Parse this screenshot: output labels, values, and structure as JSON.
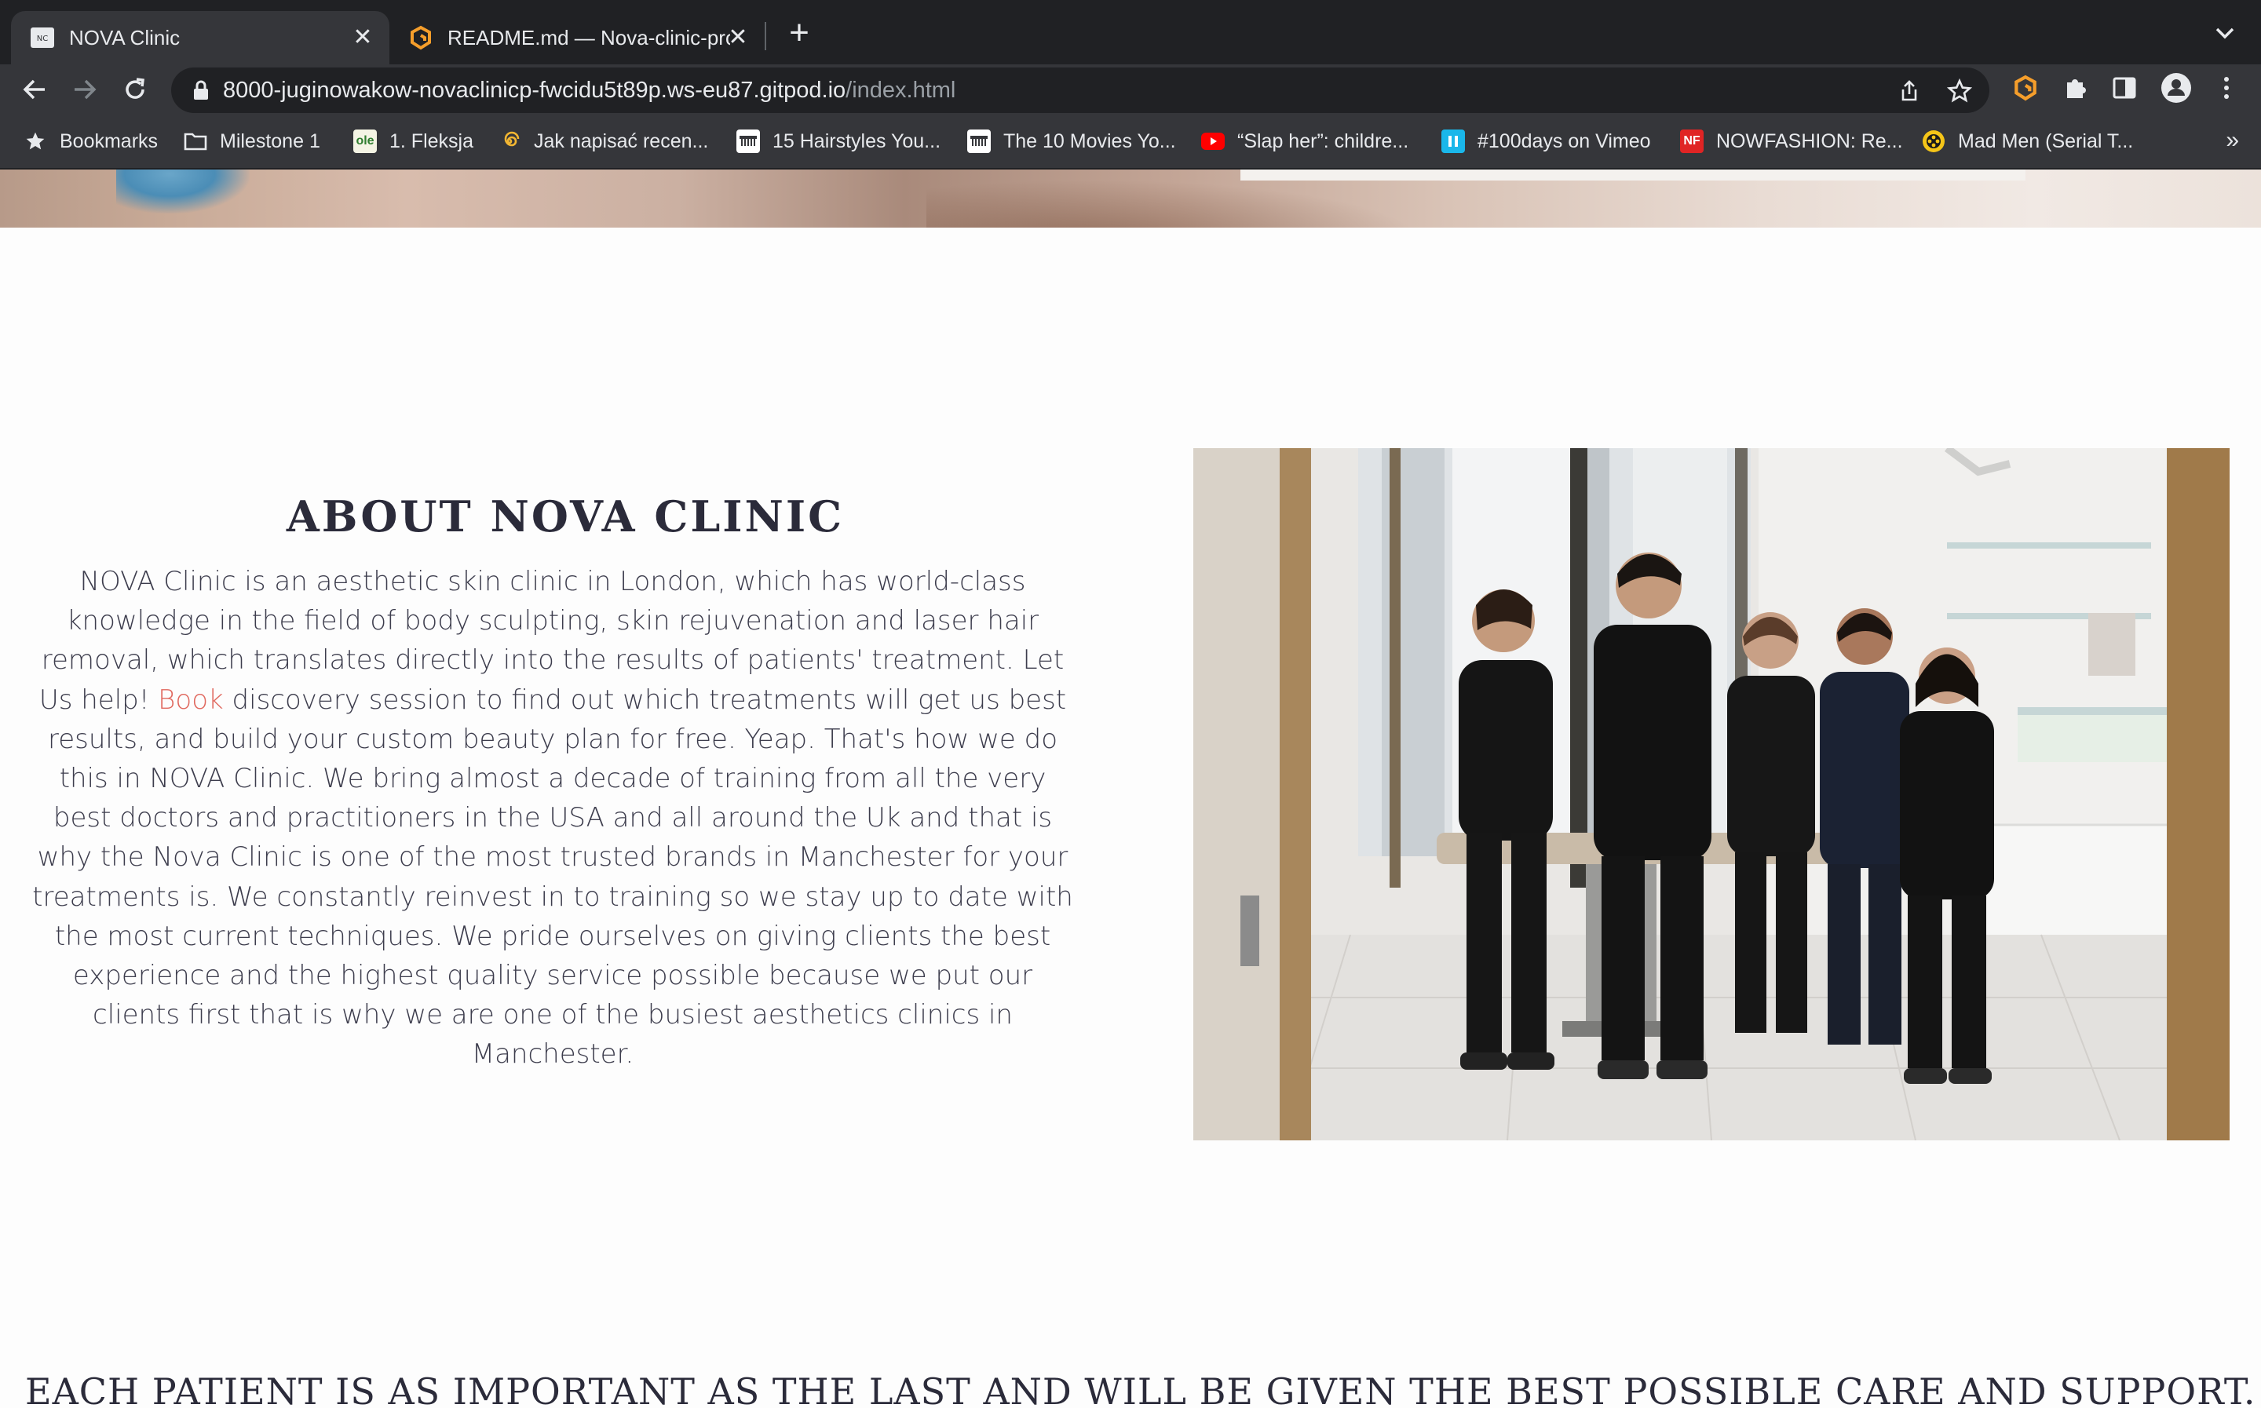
{
  "browser": {
    "tabs": [
      {
        "title": "NOVA Clinic",
        "favicon": "nova-clinic-favicon",
        "active": true
      },
      {
        "title": "README.md — Nova-clinic-pro",
        "favicon": "gitpod-favicon",
        "active": false
      }
    ],
    "url": {
      "host": "8000-juginowakow-novaclinicp-fwcidu5t89p.ws-eu87.gitpod.io",
      "path": "/index.html"
    },
    "bookmarks": [
      {
        "label": "Bookmarks",
        "icon": "star-icon"
      },
      {
        "label": "Milestone 1",
        "icon": "folder-icon"
      },
      {
        "label": "1. Fleksja",
        "icon": "ole-icon",
        "icon_text": "ole"
      },
      {
        "label": "Jak napisać recen...",
        "icon": "spiral-icon"
      },
      {
        "label": "15 Hairstyles You...",
        "icon": "comb-icon"
      },
      {
        "label": "The 10 Movies Yo...",
        "icon": "comb-icon"
      },
      {
        "label": "“Slap her”: childre...",
        "icon": "youtube-icon"
      },
      {
        "label": "#100days on Vimeo",
        "icon": "vimeo-icon"
      },
      {
        "label": "NOWFASHION: Re...",
        "icon": "nf-icon",
        "icon_text": "NF"
      },
      {
        "label": "Mad Men (Serial T...",
        "icon": "film-reel-icon"
      }
    ],
    "more_label": "»"
  },
  "about": {
    "title": "ABOUT NOVA CLINIC",
    "text_before_link": "NOVA Clinic is an aesthetic skin clinic in London, which has world-class knowledge in the field of body sculpting, skin rejuvenation and laser hair removal, which translates directly into the results of patients' treatment. Let Us help! ",
    "link_label": "Book",
    "text_after_link": " discovery session to find out which treatments will get us best results, and build your custom beauty plan for free. Yeap. That's how we do this in NOVA Clinic. We bring almost a decade of training from all the very best doctors and practitioners in the USA and all around the Uk and that is why the Nova Clinic is one of the most trusted brands in Manchester for your treatments is. We constantly reinvest in to training so we stay up to date with the most current techniques. We pride ourselves on giving clients the best experience and the highest quality service possible because we put our clients first that is why we are one of the busiest aesthetics clinics in Manchester."
  },
  "tagline": "EACH PATIENT IS AS IMPORTANT AS THE LAST AND WILL BE GIVEN THE BEST POSSIBLE CARE AND SUPPORT. WE WANT YOU",
  "colors": {
    "link": "#e0685e",
    "heading": "#2b2b3a",
    "chrome_dark": "#202124",
    "chrome_mid": "#35363a"
  }
}
